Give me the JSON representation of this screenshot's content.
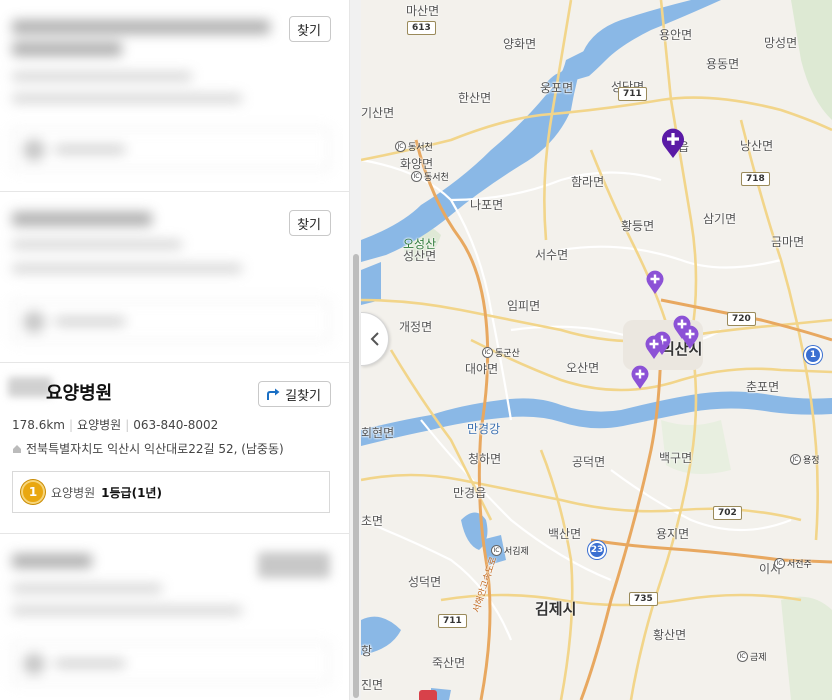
{
  "list": {
    "route_label": "길찾기",
    "route_label_partial": "찾기",
    "featured": {
      "name": "요양병원",
      "distance": "178.6km",
      "category": "요양병원",
      "phone": "063-840-8002",
      "address": "전북특별자치도 익산시 익산대로22길 52, (남중동)",
      "grade_badge": "1",
      "grade_type": "요양병원",
      "grade_value": "1등급(1년)"
    }
  },
  "map": {
    "places": [
      {
        "label": "마산면"
      },
      {
        "label": "용안면"
      },
      {
        "label": "망성면"
      },
      {
        "label": "양화면"
      },
      {
        "label": "웅포면"
      },
      {
        "label": "성당면"
      },
      {
        "label": "용동면"
      },
      {
        "label": "한산면"
      },
      {
        "label": "기산면"
      },
      {
        "label": "낭산면"
      },
      {
        "label": "화양면"
      },
      {
        "label": "함라면"
      },
      {
        "label": "나포면"
      },
      {
        "label": "황등면"
      },
      {
        "label": "삼기면"
      },
      {
        "label": "금마면"
      },
      {
        "label": "오성산"
      },
      {
        "label": "성산면"
      },
      {
        "label": "서수면"
      },
      {
        "label": "임피면"
      },
      {
        "label": "개정면"
      },
      {
        "label": "대야면"
      },
      {
        "label": "오산면"
      },
      {
        "label": "춘포면"
      },
      {
        "label": "회현면"
      },
      {
        "label": "만경강"
      },
      {
        "label": "청하면"
      },
      {
        "label": "공덕면"
      },
      {
        "label": "백구면"
      },
      {
        "label": "만경읍"
      },
      {
        "label": "백산면"
      },
      {
        "label": "용지면"
      },
      {
        "label": "초면"
      },
      {
        "label": "성덕면"
      },
      {
        "label": "죽산면"
      },
      {
        "label": "황산면"
      },
      {
        "label": "이서"
      },
      {
        "label": "읍"
      },
      {
        "label": "항"
      },
      {
        "label": "진면"
      }
    ],
    "cities": [
      {
        "label": "익산시"
      },
      {
        "label": "김제시"
      }
    ],
    "road_numbers": [
      "613",
      "711",
      "718",
      "720",
      "702",
      "735",
      "711",
      "23",
      "1"
    ],
    "interchanges": [
      {
        "label": "동서천",
        "badge": "JC"
      },
      {
        "label": "동서천",
        "badge": "IC"
      },
      {
        "label": "동군산",
        "badge": "IC"
      },
      {
        "label": "서김제",
        "badge": "IC"
      },
      {
        "label": "금제",
        "badge": "IC"
      },
      {
        "label": "서전주",
        "badge": "IC"
      },
      {
        "label": "용정",
        "badge": "JC"
      }
    ],
    "highway_label": "서해안고속도로",
    "pin_color": "#8c52d6",
    "selected_pin_color": "#5a1aa6",
    "water_color": "#8ab8e6"
  }
}
